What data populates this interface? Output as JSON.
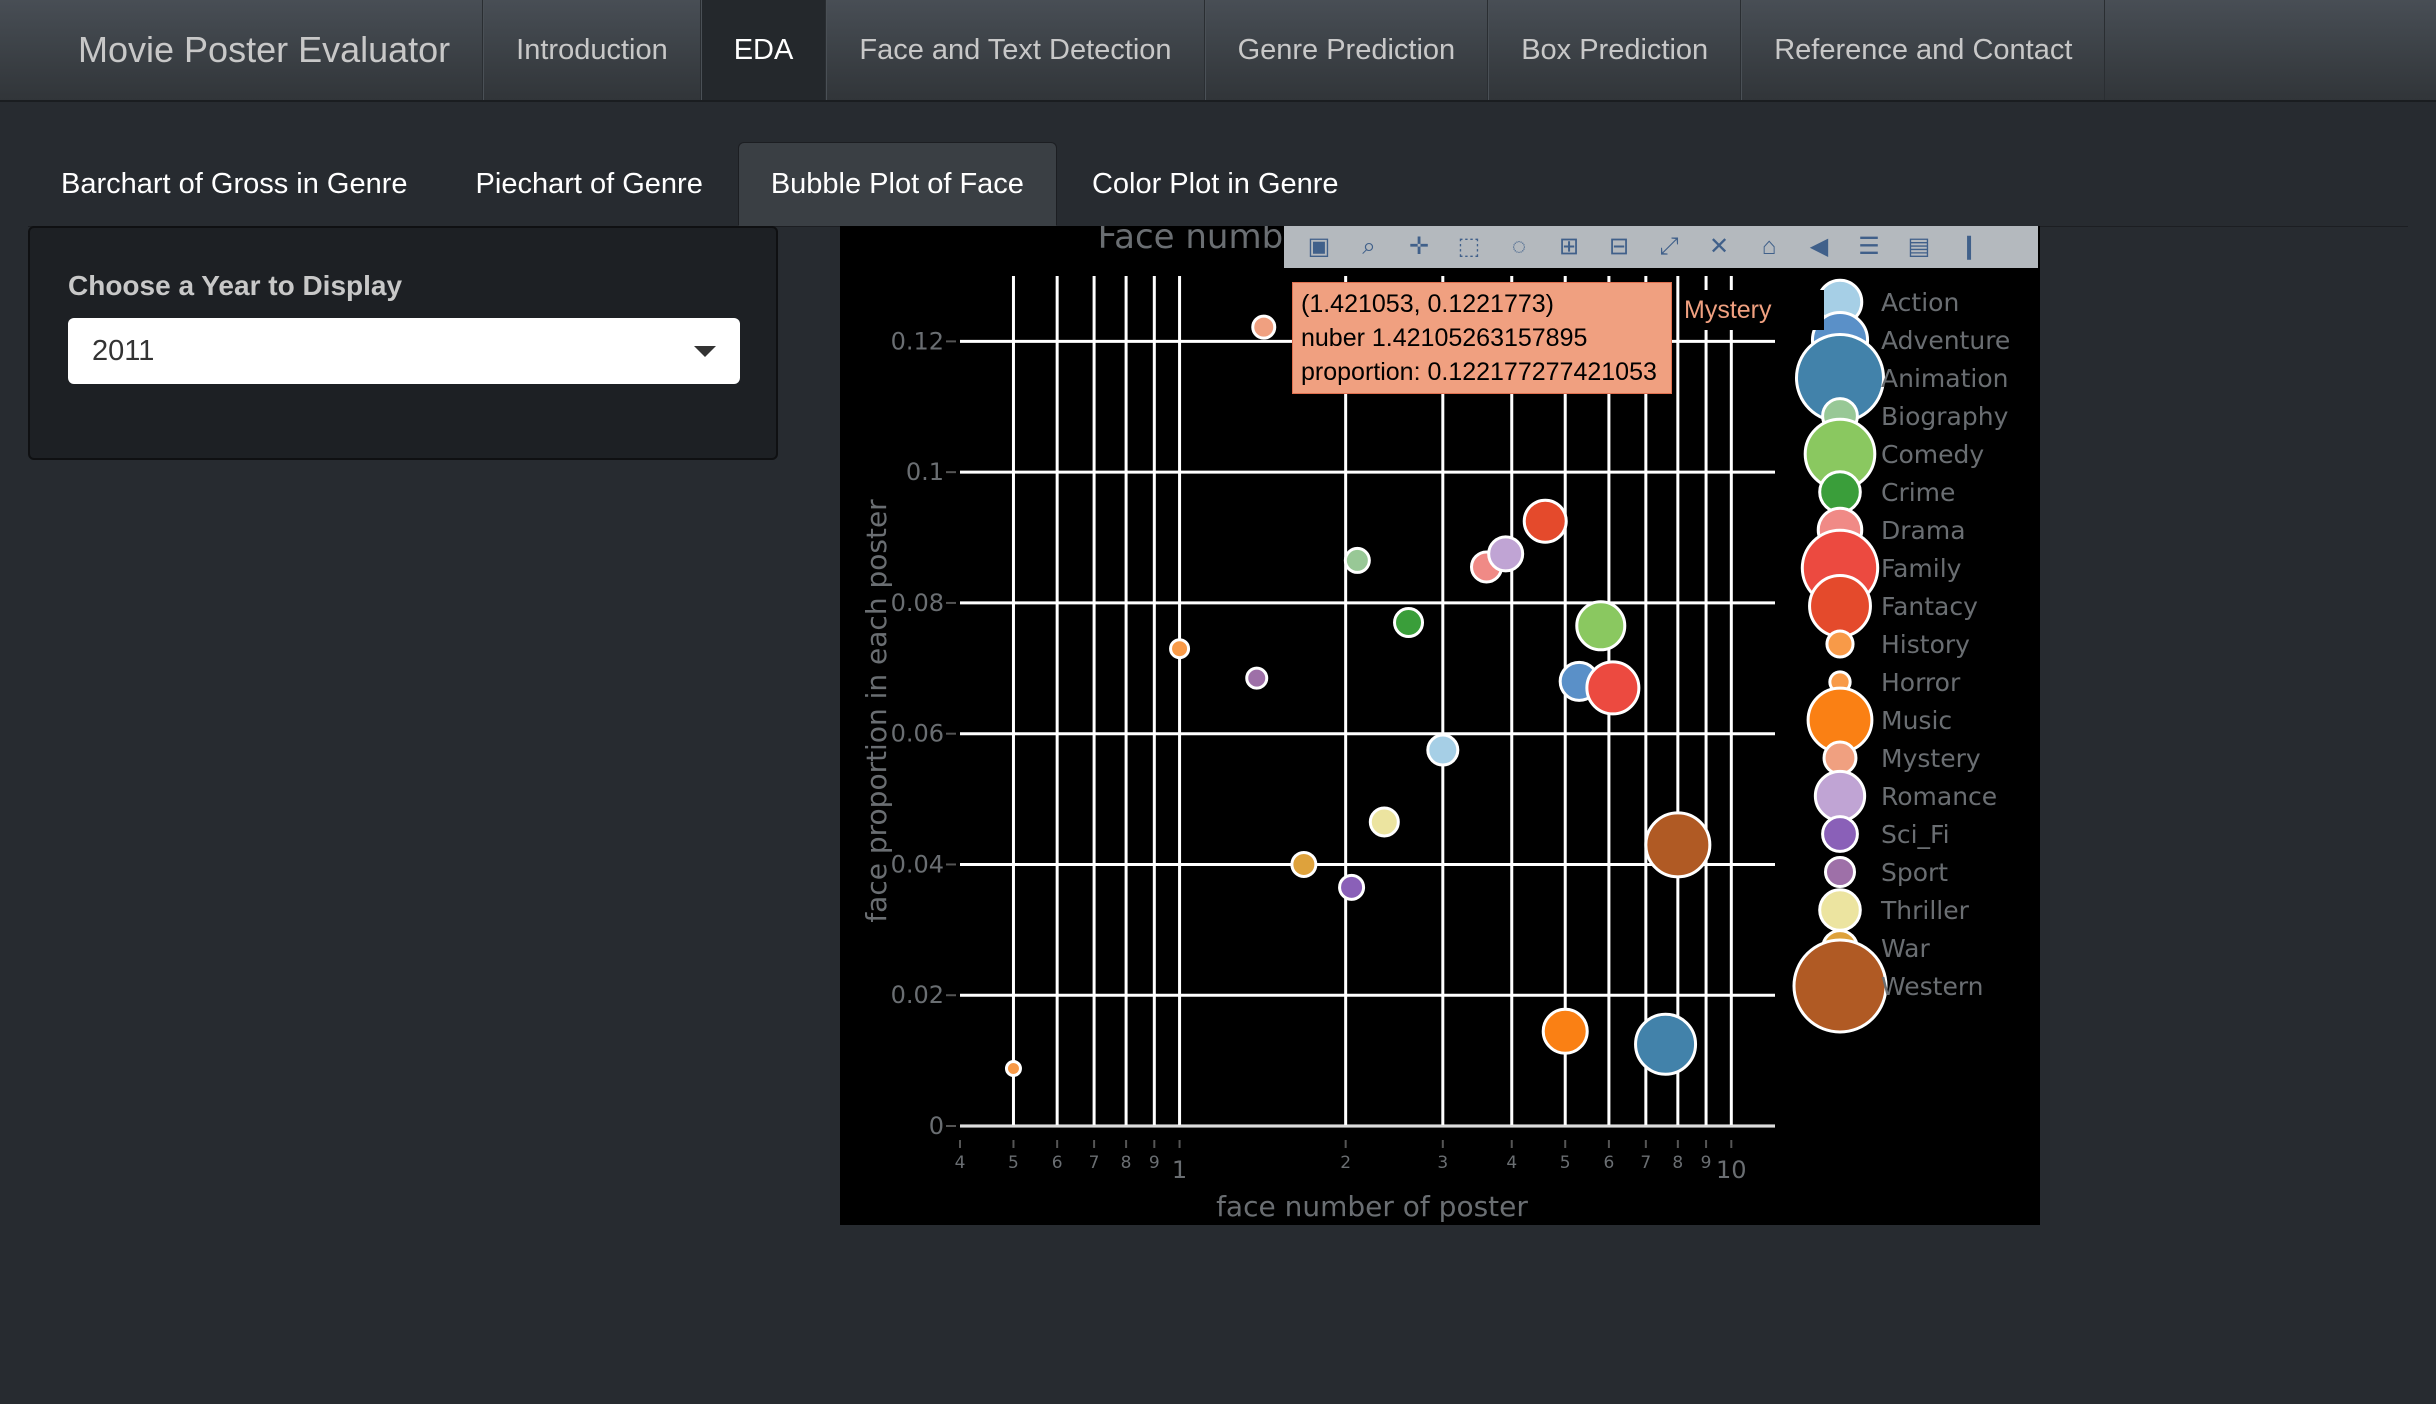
{
  "navbar": {
    "brand": "Movie Poster Evaluator",
    "items": [
      "Introduction",
      "EDA",
      "Face and Text Detection",
      "Genre Prediction",
      "Box Prediction",
      "Reference and Contact"
    ],
    "active_index": 1
  },
  "tabs": {
    "items": [
      "Barchart of Gross in Genre",
      "Piechart of Genre",
      "Bubble Plot of Face",
      "Color Plot in Genre"
    ],
    "active_index": 2
  },
  "sidebar": {
    "label": "Choose a Year to Display",
    "selected_year": "2011"
  },
  "modebar": {
    "icons": [
      "camera-icon",
      "zoom-icon",
      "pan-icon",
      "box-select-icon",
      "lasso-select-icon",
      "zoom-in-icon",
      "zoom-out-icon",
      "autoscale-icon",
      "reset-axes-icon",
      "home-icon",
      "spike-lines-icon",
      "compare-hover-icon",
      "show-closest-icon",
      "plotly-logo-icon"
    ]
  },
  "tooltip": {
    "coords": "(1.421053, 0.1221773)",
    "line2": "nuber 1.42105263157895",
    "line3": "proportion: 0.122177277421053",
    "series": "Mystery"
  },
  "chart_data": {
    "type": "scatter",
    "title": "Face number vs Face proportion",
    "xlabel": "face number of poster",
    "ylabel": "face proportion in each poster",
    "x_scale": "log",
    "xlim": [
      0.4,
      12
    ],
    "ylim": [
      0,
      0.13
    ],
    "x_tick_labels": [
      "4",
      "5",
      "6",
      "7",
      "8",
      "9",
      "1",
      "2",
      "3",
      "4",
      "5",
      "6",
      "7",
      "8",
      "9",
      "10"
    ],
    "y_tick_labels": [
      "0",
      "0.02",
      "0.04",
      "0.06",
      "0.08",
      "0.1",
      "0.12"
    ],
    "grid": true,
    "background": "#000000",
    "legend_position": "right",
    "series": [
      {
        "name": "Action",
        "color": "#a6cfe6",
        "points": [
          {
            "x": 3.0,
            "y": 0.0575,
            "size": 15
          }
        ]
      },
      {
        "name": "Adventure",
        "color": "#5a90c8",
        "points": [
          {
            "x": 5.3,
            "y": 0.068,
            "size": 19
          }
        ]
      },
      {
        "name": "Animation",
        "color": "#4282aa",
        "points": [
          {
            "x": 7.6,
            "y": 0.0125,
            "size": 30
          }
        ]
      },
      {
        "name": "Biography",
        "color": "#98c896",
        "points": [
          {
            "x": 2.1,
            "y": 0.0865,
            "size": 12
          }
        ]
      },
      {
        "name": "Comedy",
        "color": "#8ac860",
        "points": [
          {
            "x": 5.8,
            "y": 0.0765,
            "size": 24
          }
        ]
      },
      {
        "name": "Crime",
        "color": "#3a9e3a",
        "points": [
          {
            "x": 2.6,
            "y": 0.077,
            "size": 14
          }
        ]
      },
      {
        "name": "Drama",
        "color": "#f08a86",
        "points": [
          {
            "x": 3.6,
            "y": 0.0855,
            "size": 15
          }
        ]
      },
      {
        "name": "Family",
        "color": "#ec4a40",
        "points": [
          {
            "x": 6.1,
            "y": 0.067,
            "size": 26
          }
        ]
      },
      {
        "name": "Fantacy",
        "color": "#e44a2c",
        "points": [
          {
            "x": 4.6,
            "y": 0.0925,
            "size": 21
          }
        ]
      },
      {
        "name": "History",
        "color": "#f89a48",
        "points": [
          {
            "x": 1.0,
            "y": 0.073,
            "size": 9
          }
        ]
      },
      {
        "name": "Horror",
        "color": "#f89a48",
        "points": [
          {
            "x": 0.5,
            "y": 0.0088,
            "size": 7
          }
        ]
      },
      {
        "name": "Music",
        "color": "#fa8014",
        "points": [
          {
            "x": 5.0,
            "y": 0.0145,
            "size": 22
          }
        ]
      },
      {
        "name": "Mystery",
        "color": "#f0a080",
        "points": [
          {
            "x": 1.421053,
            "y": 0.1221773,
            "size": 11
          }
        ]
      },
      {
        "name": "Romance",
        "color": "#c0a4d4",
        "points": [
          {
            "x": 3.9,
            "y": 0.0875,
            "size": 17
          }
        ]
      },
      {
        "name": "Sci_Fi",
        "color": "#8a60b8",
        "points": [
          {
            "x": 2.05,
            "y": 0.0365,
            "size": 12
          }
        ]
      },
      {
        "name": "Sport",
        "color": "#9e70a8",
        "points": [
          {
            "x": 1.38,
            "y": 0.0685,
            "size": 10
          }
        ]
      },
      {
        "name": "Thriller",
        "color": "#ece4a0",
        "points": [
          {
            "x": 2.35,
            "y": 0.0465,
            "size": 14
          }
        ]
      },
      {
        "name": "War",
        "color": "#dea23c",
        "points": [
          {
            "x": 1.68,
            "y": 0.04,
            "size": 12
          }
        ]
      },
      {
        "name": "Western",
        "color": "#b05a24",
        "points": [
          {
            "x": 8.0,
            "y": 0.043,
            "size": 32
          }
        ]
      }
    ]
  }
}
